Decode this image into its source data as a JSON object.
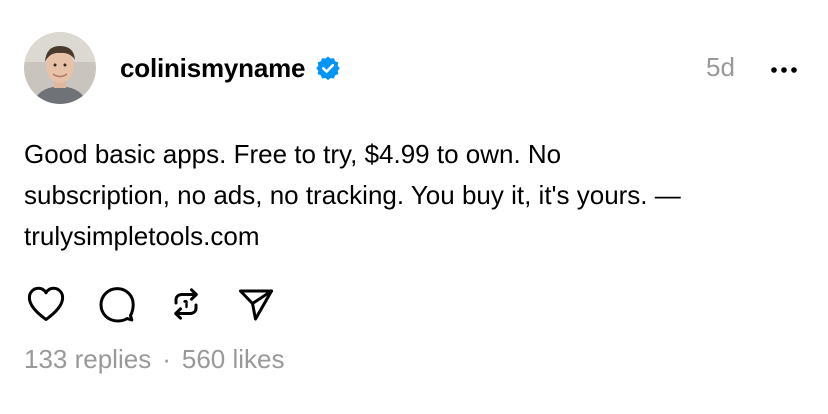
{
  "post": {
    "username": "colinismyname",
    "verified": true,
    "timestamp": "5d",
    "text_lines": [
      "Good basic apps. Free to try, $4.99 to own. No",
      "subscription, no ads, no tracking. You buy it, it's yours. —",
      "trulysimpletools.com"
    ],
    "replies": "133 replies",
    "separator": "·",
    "likes": "560 likes"
  },
  "icons": {
    "verified": "verified-badge-icon",
    "more": "more-horizontal-icon",
    "like": "heart-icon",
    "reply": "comment-icon",
    "repost": "repost-icon",
    "share": "send-icon"
  },
  "colors": {
    "text": "#000000",
    "muted": "#999999",
    "verified": "#0095f6"
  }
}
